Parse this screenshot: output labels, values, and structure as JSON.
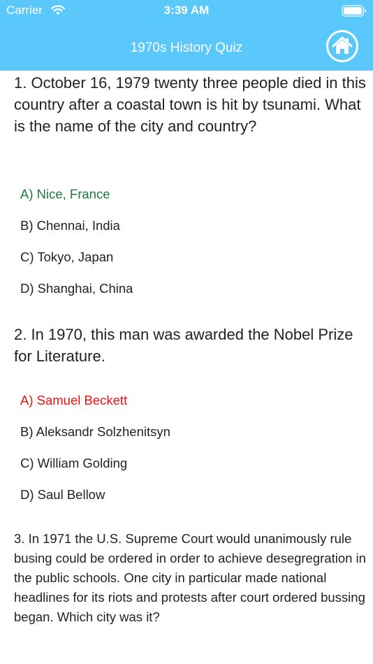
{
  "status_bar": {
    "carrier": "Carrier",
    "time": "3:39 AM"
  },
  "nav": {
    "title": "1970s History Quiz",
    "home_icon": "home-icon"
  },
  "colors": {
    "header": "#5ac8fa",
    "correct": "#1f7a38",
    "wrong": "#ee1111"
  },
  "questions": [
    {
      "text": "1. October 16, 1979 twenty three people died in this country after a coastal town is hit by tsunami. What is the name of the city and country?",
      "answers": [
        "A) Nice, France",
        "B) Chennai, India",
        "C) Tokyo, Japan",
        "D) Shanghai, China"
      ]
    },
    {
      "text": "2. In 1970, this man was awarded the Nobel Prize for Literature.",
      "answers": [
        "A) Samuel Beckett",
        "B) Aleksandr Solzhenitsyn",
        "C) William Golding",
        "D) Saul Bellow"
      ]
    },
    {
      "text": "3. In 1971 the U.S. Supreme Court would unanimously rule busing could be ordered in order to achieve desegregration in the public schools. One city in particular made national headlines for its riots and protests after court ordered bussing began. Which city was it?"
    }
  ]
}
